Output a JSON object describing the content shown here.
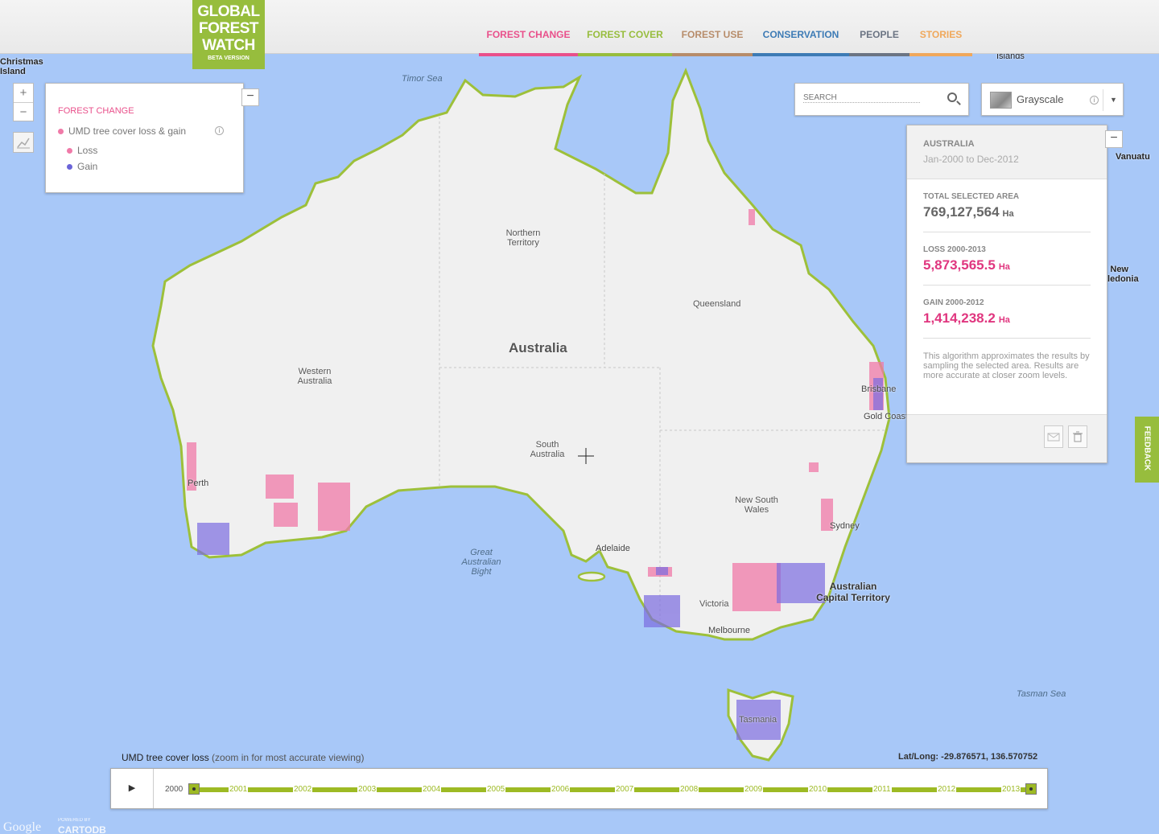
{
  "logo": {
    "line1": "GLOBAL",
    "line2": "FOREST",
    "line3": "WATCH",
    "tag": "BETA VERSION"
  },
  "nav": [
    {
      "label": "FOREST CHANGE",
      "color": "#e9508b"
    },
    {
      "label": "FOREST COVER",
      "color": "#97bd3d"
    },
    {
      "label": "FOREST USE",
      "color": "#b78c6a"
    },
    {
      "label": "CONSERVATION",
      "color": "#3d7bb5"
    },
    {
      "label": "PEOPLE",
      "color": "#6b7483"
    },
    {
      "label": "STORIES",
      "color": "#f0a85b"
    }
  ],
  "zoom": {
    "in": "+",
    "out": "−"
  },
  "legend": {
    "category": "FOREST CHANGE",
    "layer": "UMD tree cover loss & gain",
    "info": "i",
    "items": [
      {
        "label": "Loss",
        "color": "#f07aa8"
      },
      {
        "label": "Gain",
        "color": "#6b64d8"
      }
    ],
    "collapse": "−"
  },
  "search": {
    "placeholder": "SEARCH"
  },
  "basemap": {
    "label": "Grayscale",
    "info": "i",
    "caret": "▼"
  },
  "stats": {
    "collapse": "−",
    "country": "AUSTRALIA",
    "range": "Jan-2000 to Dec-2012",
    "total_title": "TOTAL SELECTED AREA",
    "total_value": "769,127,564",
    "loss_title": "LOSS 2000-2013",
    "loss_value": "5,873,565.5",
    "gain_title": "GAIN 2000-2012",
    "gain_value": "1,414,238.2",
    "unit": "Ha",
    "note": "This algorithm approximates the results by sampling the selected area. Results are more accurate at closer zoom levels.",
    "accent": "#e0367f"
  },
  "feedback": "FEEDBACK",
  "map_labels": {
    "christmas": "Christmas\nIsland",
    "timor_sea": "Timor Sea",
    "islands": "Islands",
    "vanuatu": "Vanuatu",
    "new_caledonia": "New\nCaledonia",
    "country": "Australia",
    "northern_territory": "Northern\nTerritory",
    "queensland": "Queensland",
    "western_australia": "Western\nAustralia",
    "south_australia": "South\nAustralia",
    "new_south_wales": "New South\nWales",
    "victoria": "Victoria",
    "tasmania": "Tasmania",
    "act": "Australian\nCapital Territory",
    "bight": "Great\nAustralian\nBight",
    "tasman_sea": "Tasman Sea",
    "brisbane": "Brisbane",
    "gold_coast": "Gold Coast",
    "sydney": "Sydney",
    "adelaide": "Adelaide",
    "melbourne": "Melbourne",
    "perth": "Perth"
  },
  "timeline": {
    "title": "UMD tree cover loss",
    "subtitle": "(zoom in for most accurate viewing)",
    "latlong_label": "Lat/Long:",
    "latlong": "-29.876571, 136.570752",
    "play": "▶",
    "years": [
      "2000",
      "2001",
      "2002",
      "2003",
      "2004",
      "2005",
      "2006",
      "2007",
      "2008",
      "2009",
      "2010",
      "2011",
      "2012",
      "2013"
    ],
    "start_year": "2000",
    "end_year": "2013"
  },
  "attribution": {
    "google": "Google",
    "powered": "POWERED BY",
    "cartodb": "CARTODB"
  },
  "colors": {
    "ocean": "#a8c8f8",
    "land": "#f0f0f0",
    "coast": "#9dc03a",
    "loss": "#f07aa8",
    "gain": "#7b6be0"
  }
}
